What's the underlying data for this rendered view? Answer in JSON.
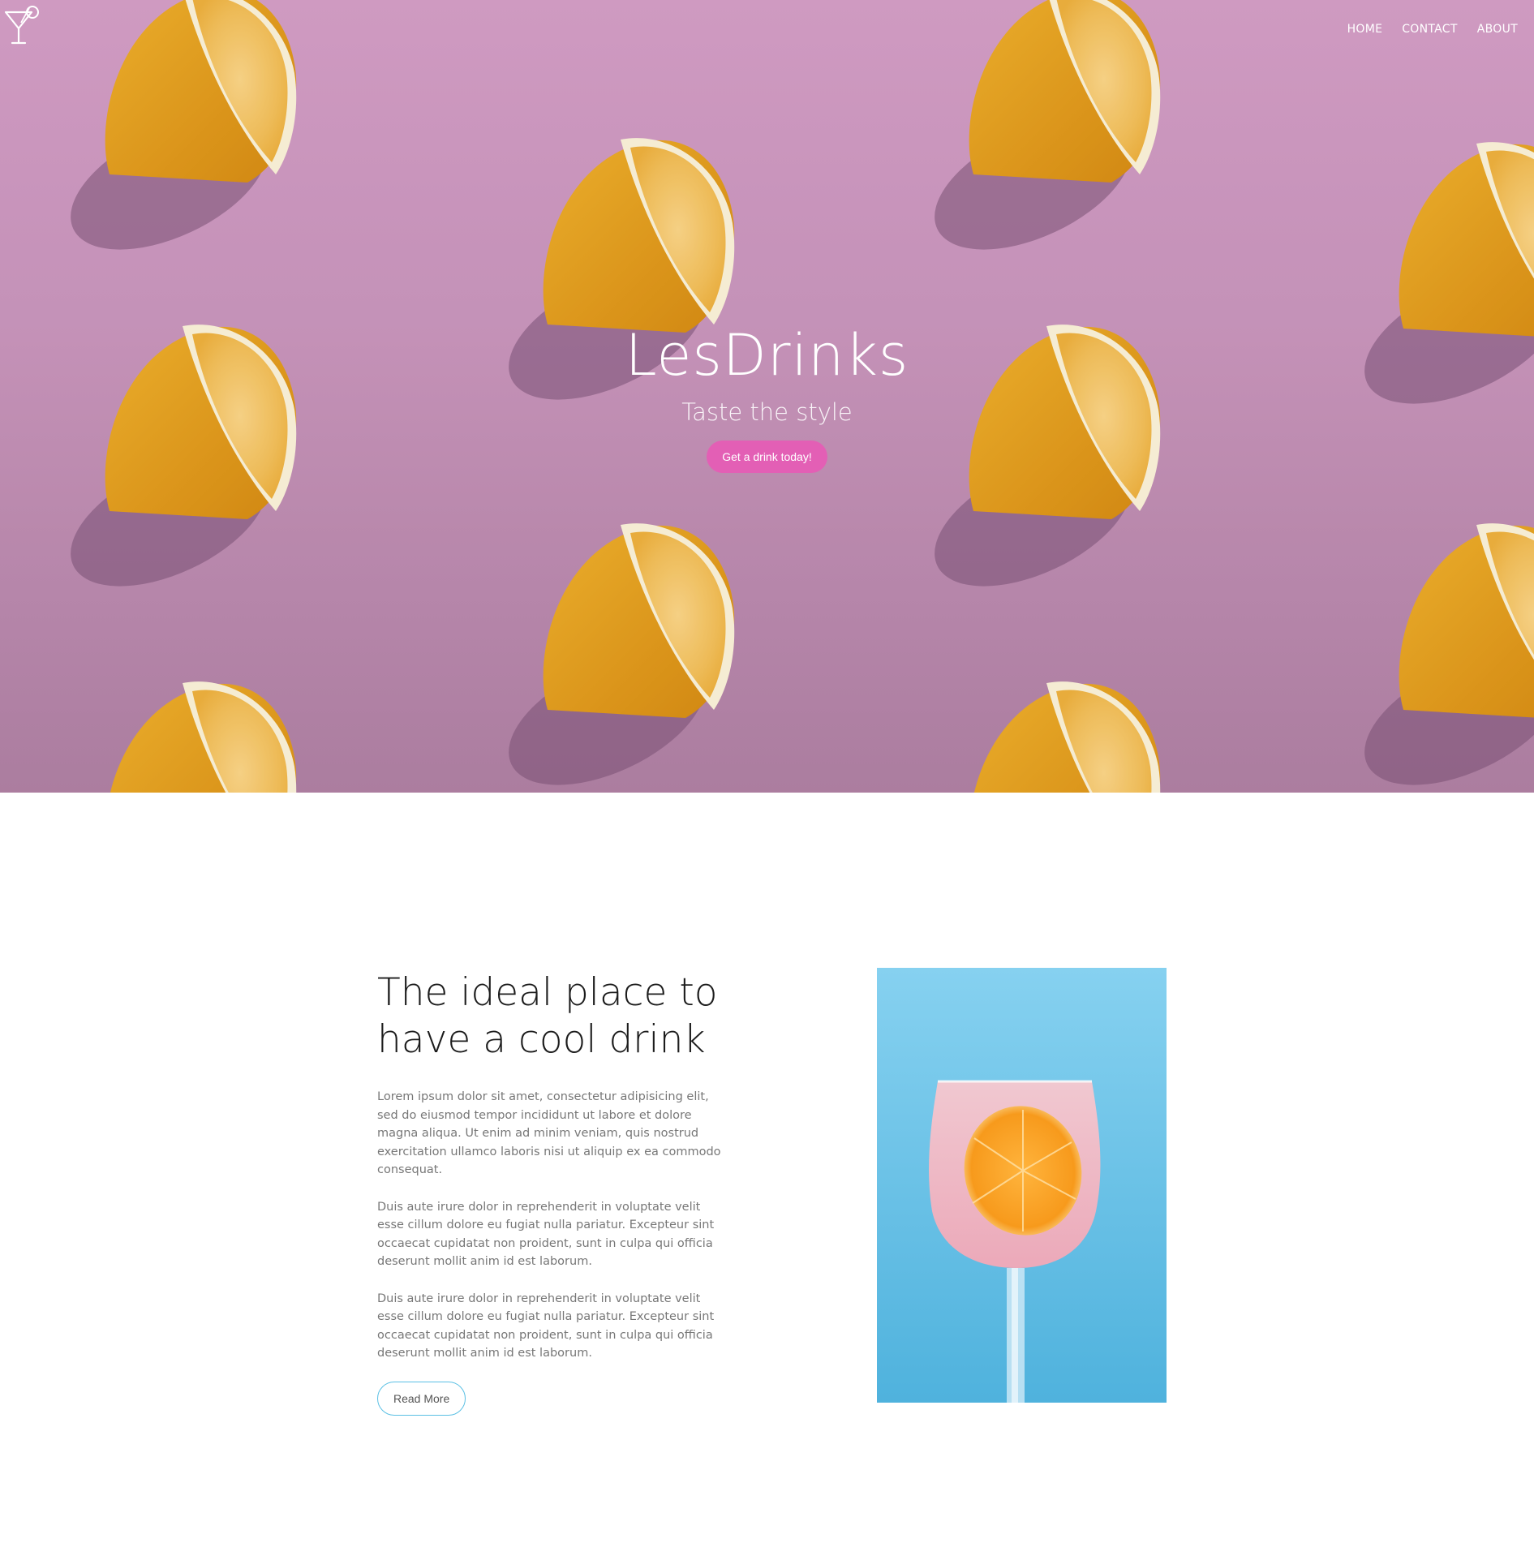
{
  "header": {
    "logo_icon": "cocktail-glass-icon",
    "nav": [
      {
        "label": "HOME"
      },
      {
        "label": "CONTACT"
      },
      {
        "label": "ABOUT"
      }
    ]
  },
  "hero": {
    "title": "LesDrinks",
    "subtitle": "Taste the style",
    "cta_label": "Get a drink today!",
    "background_image": "lemon-halves-on-pink",
    "accent_color": "#e35fb5"
  },
  "about": {
    "heading_line1": "The ideal place to",
    "heading_line2": "have a cool drink",
    "paragraphs": [
      "Lorem ipsum dolor sit amet, consectetur adipisicing elit, sed do eiusmod tempor incididunt ut labore et dolore magna aliqua. Ut enim ad minim veniam, quis nostrud exercitation ullamco laboris nisi ut aliquip ex ea commodo consequat.",
      "Duis aute irure dolor in reprehenderit in voluptate velit esse cillum dolore eu fugiat nulla pariatur. Excepteur sint occaecat cupidatat non proident, sunt in culpa qui officia deserunt mollit anim id est laborum.",
      "Duis aute irure dolor in reprehenderit in voluptate velit esse cillum dolore eu fugiat nulla pariatur. Excepteur sint occaecat cupidatat non proident, sunt in culpa qui officia deserunt mollit anim id est laborum."
    ],
    "read_more_label": "Read More",
    "button_border_color": "#5bc0e4",
    "image": "pink-cocktail-with-orange-slice-on-blue"
  }
}
